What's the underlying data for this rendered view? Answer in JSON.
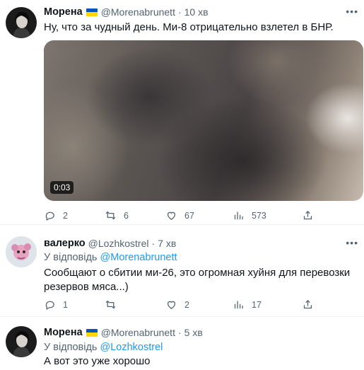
{
  "tweets": [
    {
      "name": "Морена",
      "handle": "@Morenabrunett",
      "time": "10 хв",
      "text": "Ну, что за чудный день. Ми-8 отрицательно взлетел в БНР.",
      "video_duration": "0:03",
      "replies": "2",
      "retweets": "6",
      "likes": "67",
      "views": "573"
    },
    {
      "name": "валерко",
      "handle": "@Lozhkostrel",
      "time": "7 хв",
      "reply_prefix": "У відповідь",
      "reply_to": "@Morenabrunett",
      "text": "Сообщают о сбитии ми-26, это огромная хуйня для перевозки резервов мяса...)",
      "replies": "1",
      "retweets": "",
      "likes": "2",
      "views": "17"
    },
    {
      "name": "Морена",
      "handle": "@Morenabrunett",
      "time": "5 хв",
      "reply_prefix": "У відповідь",
      "reply_to": "@Lozhkostrel",
      "text": "А вот это уже хорошо"
    }
  ],
  "icons": {
    "flag": "ukraine-flag-icon",
    "more": "more-icon",
    "reply": "reply-icon",
    "retweet": "retweet-icon",
    "like": "like-icon",
    "views": "views-icon",
    "share": "share-icon"
  },
  "colors": {
    "link": "#1d9bf0",
    "secondary": "#536471",
    "flag_blue": "#0057b7",
    "flag_yellow": "#ffd700"
  }
}
